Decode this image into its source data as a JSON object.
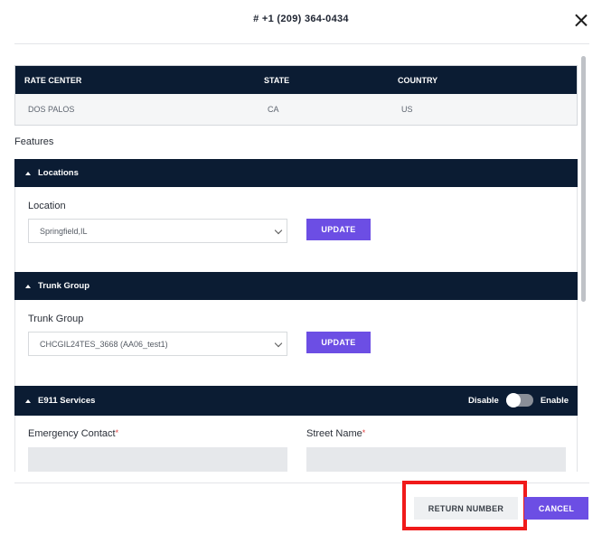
{
  "modal": {
    "title": "# +1 (209) 364-0434",
    "close_icon": "close-icon"
  },
  "rate_center_table": {
    "headers": [
      "RATE CENTER",
      "STATE",
      "COUNTRY"
    ],
    "row": [
      "DOS PALOS",
      "CA",
      "US"
    ]
  },
  "features": {
    "label": "Features"
  },
  "locations": {
    "header": "Locations",
    "field_label": "Location",
    "selected": "Springfield,IL",
    "update_label": "UPDATE"
  },
  "trunk_group": {
    "header": "Trunk Group",
    "field_label": "Trunk Group",
    "selected": "CHCGIL24TES_3668 (AA06_test1)",
    "update_label": "UPDATE"
  },
  "e911": {
    "header": "E911 Services",
    "disable_label": "Disable",
    "enable_label": "Enable",
    "toggle_state": "disabled",
    "emergency_contact_label": "Emergency Contact",
    "street_name_label": "Street Name",
    "required_mark": "*",
    "emergency_contact_value": "",
    "street_name_value": ""
  },
  "footer": {
    "return_label": "RETURN NUMBER",
    "cancel_label": "CANCEL"
  },
  "colors": {
    "header_bg": "#0b1c33",
    "accent": "#6c4ee4",
    "highlight": "#f01a1a"
  }
}
